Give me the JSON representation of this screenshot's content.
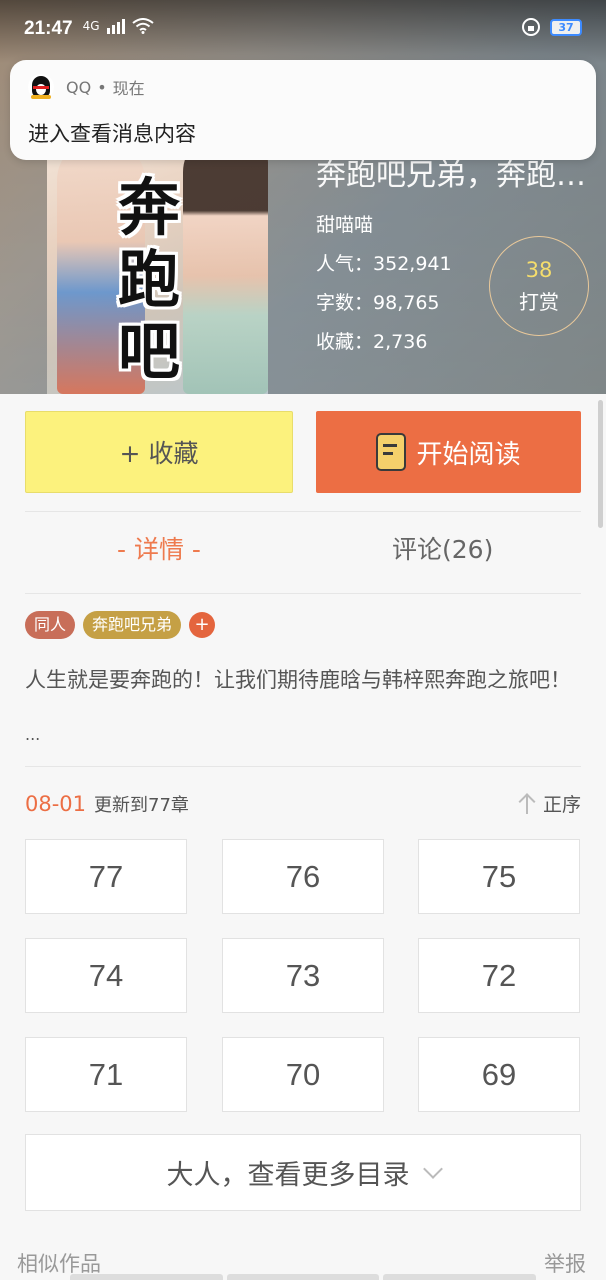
{
  "status_bar": {
    "time": "21:47",
    "signal": "4G",
    "battery": "37"
  },
  "notification": {
    "app": "QQ",
    "separator": "•",
    "time": "现在",
    "message": "进入查看消息内容"
  },
  "cover": {
    "title_chars": [
      "奔",
      "跑",
      "吧"
    ]
  },
  "book": {
    "title": "奔跑吧兄弟，奔跑吧...",
    "author": "甜喵喵",
    "popularity_label": "人气：",
    "popularity": "352,941",
    "words_label": "字数：",
    "words": "98,765",
    "favorites_label": "收藏：",
    "favorites": "2,736"
  },
  "reward": {
    "count": "38",
    "label": "打赏"
  },
  "actions": {
    "collect": "+ 收藏",
    "read": "开始阅读"
  },
  "tabs": {
    "detail": "- 详情 -",
    "comments": "评论(26)"
  },
  "tags": {
    "tongren": "同人",
    "series": "奔跑吧兄弟",
    "add": "+"
  },
  "description": {
    "text": "人生就是要奔跑的！让我们期待鹿晗与韩梓熙奔跑之旅吧！",
    "more": "..."
  },
  "update": {
    "date": "08-01",
    "text": "更新到77章",
    "order": "正序"
  },
  "chapters": [
    "77",
    "76",
    "75",
    "74",
    "73",
    "72",
    "71",
    "70",
    "69"
  ],
  "more_catalog": "大人，查看更多目录",
  "footer": {
    "similar": "相似作品",
    "report": "举报"
  },
  "colors": {
    "accent": "#ec6e44",
    "collect_button": "#fcf27d",
    "reward_count": "#f5dd6c",
    "tag_tongren": "#c86e59",
    "tag_series": "#c5a045"
  }
}
